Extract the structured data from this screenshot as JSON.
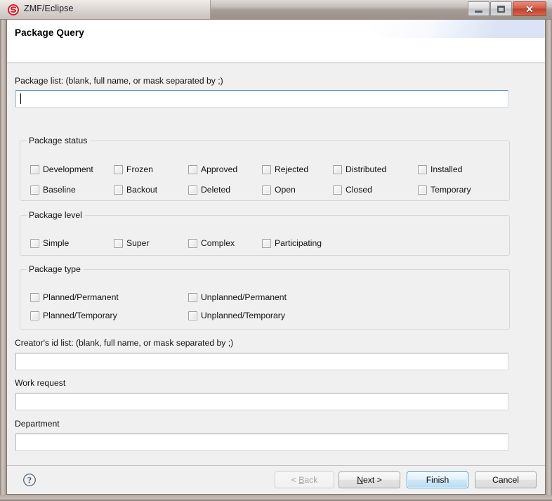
{
  "window": {
    "title": "ZMF/Eclipse",
    "app_icon": "serena-s-logo-icon",
    "controls": {
      "minimize": "Minimize",
      "maximize": "Maximize",
      "close": "Close",
      "close_glyph": "✕"
    }
  },
  "wizard": {
    "page_title": "Package Query"
  },
  "package_list": {
    "label": "Package list:  (blank, full name, or mask separated by ;)",
    "value": "",
    "placeholder": "",
    "focused": true
  },
  "package_status": {
    "legend": "Package status",
    "items": [
      {
        "label": "Development",
        "checked": false
      },
      {
        "label": "Frozen",
        "checked": false
      },
      {
        "label": "Approved",
        "checked": false
      },
      {
        "label": "Rejected",
        "checked": false
      },
      {
        "label": "Distributed",
        "checked": false
      },
      {
        "label": "Installed",
        "checked": false
      },
      {
        "label": "Baseline",
        "checked": false
      },
      {
        "label": "Backout",
        "checked": false
      },
      {
        "label": "Deleted",
        "checked": false
      },
      {
        "label": "Open",
        "checked": false
      },
      {
        "label": "Closed",
        "checked": false
      },
      {
        "label": "Temporary",
        "checked": false
      }
    ]
  },
  "package_level": {
    "legend": "Package level",
    "items": [
      {
        "label": "Simple",
        "checked": false
      },
      {
        "label": "Super",
        "checked": false
      },
      {
        "label": "Complex",
        "checked": false
      },
      {
        "label": "Participating",
        "checked": false
      }
    ]
  },
  "package_type": {
    "legend": "Package type",
    "items": [
      {
        "label": "Planned/Permanent",
        "checked": false
      },
      {
        "label": "Unplanned/Permanent",
        "checked": false
      },
      {
        "label": "Planned/Temporary",
        "checked": false
      },
      {
        "label": "Unplanned/Temporary",
        "checked": false
      }
    ]
  },
  "creator_id_list": {
    "label": "Creator's id list:  (blank, full name, or mask separated by ;)",
    "value": ""
  },
  "work_request": {
    "label": "Work request",
    "value": ""
  },
  "department": {
    "label": "Department",
    "value": ""
  },
  "footer": {
    "help_icon": "help-question-icon",
    "buttons": {
      "back": {
        "label": "< Back",
        "mnemonic": "B",
        "enabled": false,
        "default": false
      },
      "next": {
        "label": "Next >",
        "mnemonic": "N",
        "enabled": true,
        "default": false
      },
      "finish": {
        "label": "Finish",
        "enabled": true,
        "default": true
      },
      "cancel": {
        "label": "Cancel",
        "enabled": true,
        "default": false
      }
    }
  },
  "colors": {
    "dialog_bg": "#f0f0f0",
    "header_bg": "#ffffff",
    "default_button_accent": "#3c97c9",
    "close_button": "#c94a33",
    "logo_red": "#d61f26",
    "help_icon": "#4a5a74"
  }
}
